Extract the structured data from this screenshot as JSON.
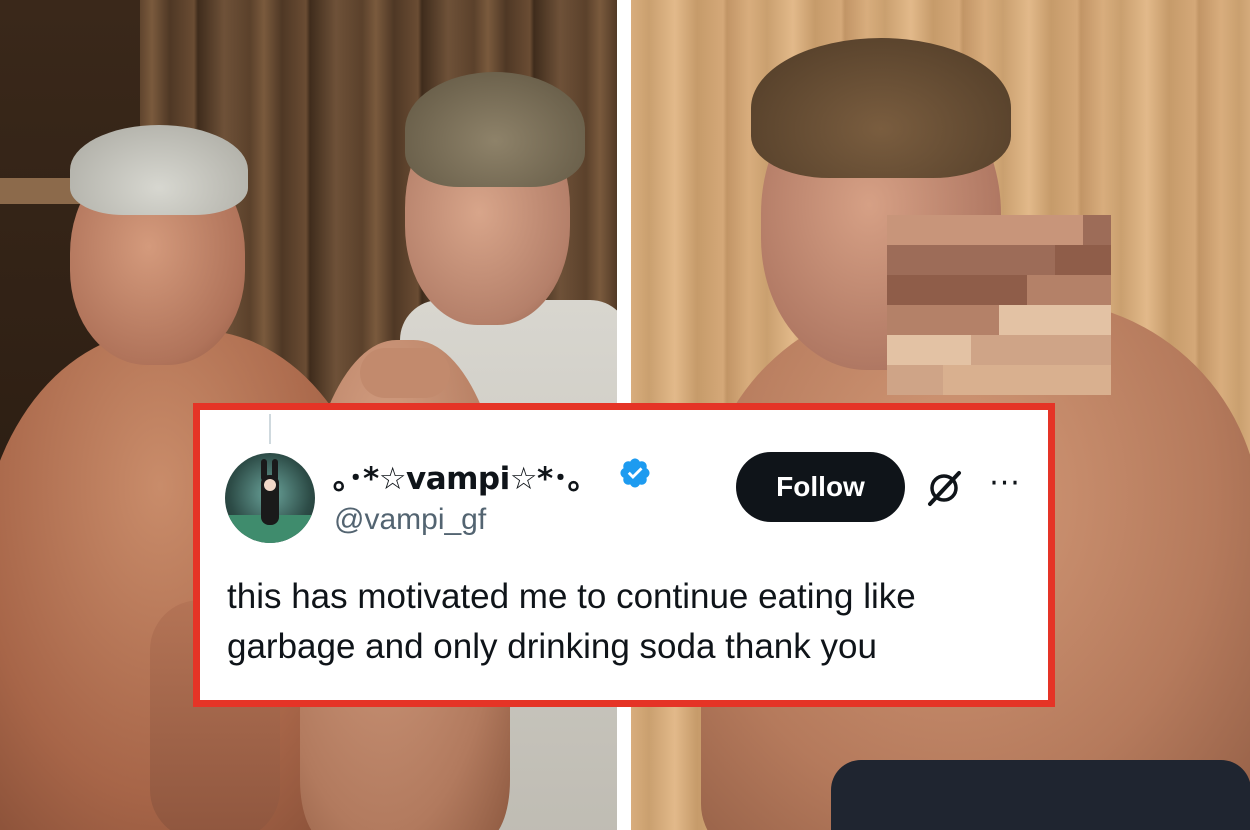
{
  "tweet": {
    "display_name": "｡･*☆vampi☆*･｡",
    "handle": "@vampi_gf",
    "verified": true,
    "follow_label": "Follow",
    "more_label": "···",
    "text": "this has motivated me to continue eating like garbage and only drinking soda thank you",
    "icons": {
      "verified": "verified-badge-icon",
      "grok": "grok-icon",
      "more": "more-options-icon"
    }
  },
  "colors": {
    "frame_border": "#e53426",
    "verified_blue": "#1d9bf0",
    "follow_bg": "#0f1419",
    "handle_gray": "#536471"
  },
  "pixel_palette": [
    "#c8957a",
    "#b48168",
    "#d9b08f",
    "#9d6c58",
    "#e3c2a4",
    "#a97860",
    "#8f5d49",
    "#cfa487"
  ]
}
